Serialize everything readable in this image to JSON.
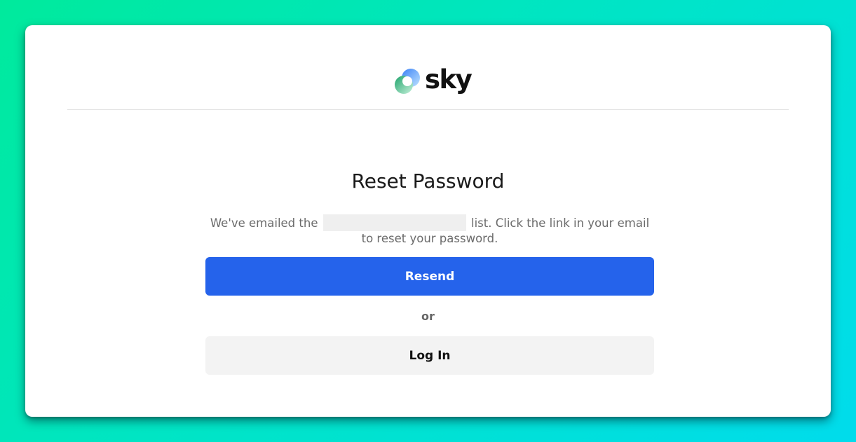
{
  "brand": {
    "name": "sky",
    "logo_icon": "sky-logo-icon"
  },
  "page": {
    "title": "Reset Password",
    "message_before": "We've emailed the",
    "message_after": "list. Click the link in your email to reset your password.",
    "separator": "or"
  },
  "actions": {
    "resend_label": "Resend",
    "login_label": "Log In"
  },
  "colors": {
    "primary": "#2563eb",
    "secondary_bg": "#f3f3f3",
    "background_start": "#00ea9c",
    "background_end": "#00dcec"
  }
}
